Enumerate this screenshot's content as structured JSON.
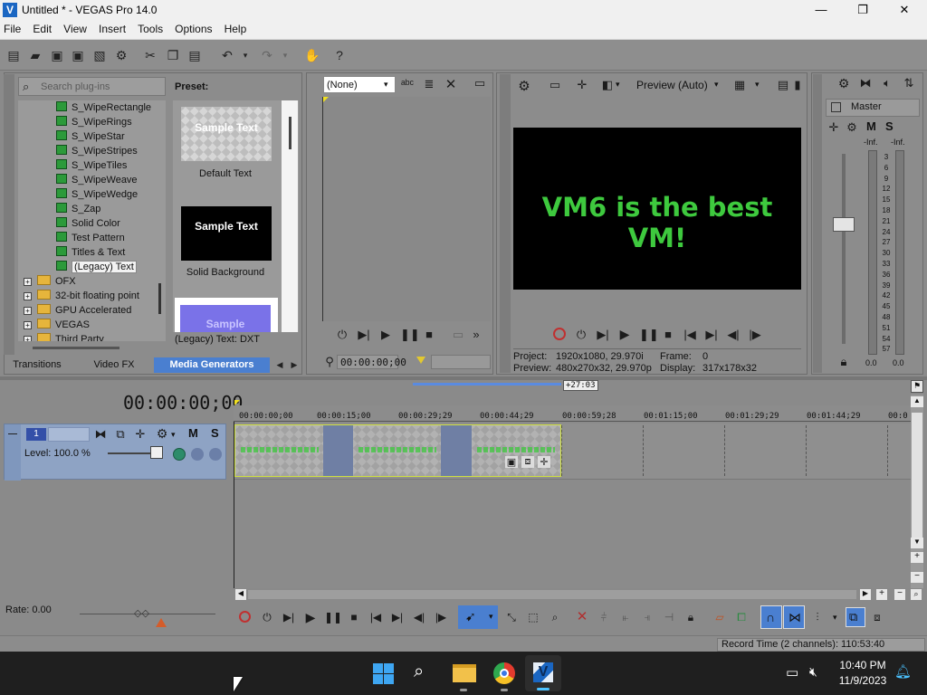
{
  "window": {
    "title": "Untitled * - VEGAS Pro 14.0",
    "app_icon": "vegas-logo-icon",
    "minimize": "—",
    "maximize": "❐",
    "close": "✕"
  },
  "menu": [
    "File",
    "Edit",
    "View",
    "Insert",
    "Tools",
    "Options",
    "Help"
  ],
  "plugin_panel": {
    "search_placeholder": "Search plug-ins",
    "preset_label": "Preset:",
    "tree": [
      {
        "label": "S_WipeRectangle",
        "type": "plugin"
      },
      {
        "label": "S_WipeRings",
        "type": "plugin"
      },
      {
        "label": "S_WipeStar",
        "type": "plugin"
      },
      {
        "label": "S_WipeStripes",
        "type": "plugin"
      },
      {
        "label": "S_WipeTiles",
        "type": "plugin"
      },
      {
        "label": "S_WipeWeave",
        "type": "plugin"
      },
      {
        "label": "S_WipeWedge",
        "type": "plugin"
      },
      {
        "label": "S_Zap",
        "type": "plugin"
      },
      {
        "label": "Solid Color",
        "type": "plugin"
      },
      {
        "label": "Test Pattern",
        "type": "plugin"
      },
      {
        "label": "Titles & Text",
        "type": "plugin"
      },
      {
        "label": "(Legacy) Text",
        "type": "plugin",
        "selected": true
      },
      {
        "label": "OFX",
        "type": "folder"
      },
      {
        "label": "32-bit floating point",
        "type": "folder"
      },
      {
        "label": "GPU Accelerated",
        "type": "folder"
      },
      {
        "label": "VEGAS",
        "type": "folder"
      },
      {
        "label": "Third Party",
        "type": "folder"
      }
    ],
    "presets": [
      {
        "thumb_text": "Sample Text",
        "label": "Default Text"
      },
      {
        "thumb_text": "Sample Text",
        "label": "Solid Background"
      },
      {
        "thumb_text": "Sample",
        "label": "(Legacy) Text: DXT"
      }
    ],
    "tabs": [
      "Transitions",
      "Video FX",
      "Media Generators"
    ]
  },
  "trimmer": {
    "dropdown_value": "(None)",
    "timecode": "00:00:00;00"
  },
  "preview": {
    "quality": "Preview (Auto)",
    "screen_text": "VM6 is the best VM!",
    "screen_text_color": "#3ec93e",
    "project_label": "Project:",
    "project_value": "1920x1080, 29.970i",
    "frame_label": "Frame:",
    "frame_value": "0",
    "preview_label": "Preview:",
    "preview_value": "480x270x32, 29.970p",
    "display_label": "Display:",
    "display_value": "317x178x32"
  },
  "mixer": {
    "master_label": "Master",
    "mute": "M",
    "solo": "S",
    "inf_left": "-Inf.",
    "inf_right": "-Inf.",
    "scale": [
      "3",
      "6",
      "9",
      "12",
      "15",
      "18",
      "21",
      "24",
      "27",
      "30",
      "33",
      "36",
      "39",
      "42",
      "45",
      "48",
      "51",
      "54",
      "57"
    ],
    "value_left": "0.0",
    "value_right": "0.0"
  },
  "timeline": {
    "main_timecode": "00:00:00;00",
    "ruler": [
      "00:00:00;00",
      "00:00:15;00",
      "00:00:29;29",
      "00:00:44;29",
      "00:00:59;28",
      "00:01:15;00",
      "00:01:29;29",
      "00:01:44;29",
      "00:0"
    ],
    "ruler_badge": "+27:03",
    "track_number": "1",
    "track_level": "Level: 100.0 %",
    "track_mute": "M",
    "track_solo": "S",
    "rate": "Rate: 0.00"
  },
  "status": {
    "record_time": "Record Time (2 channels): 110:53:40"
  },
  "taskbar": {
    "time": "10:40 PM",
    "date": "11/9/2023"
  },
  "colors": {
    "accent_blue": "#4a7fd0",
    "track_header": "#8ea3c4",
    "timeline_bg": "#8b8b8b"
  }
}
